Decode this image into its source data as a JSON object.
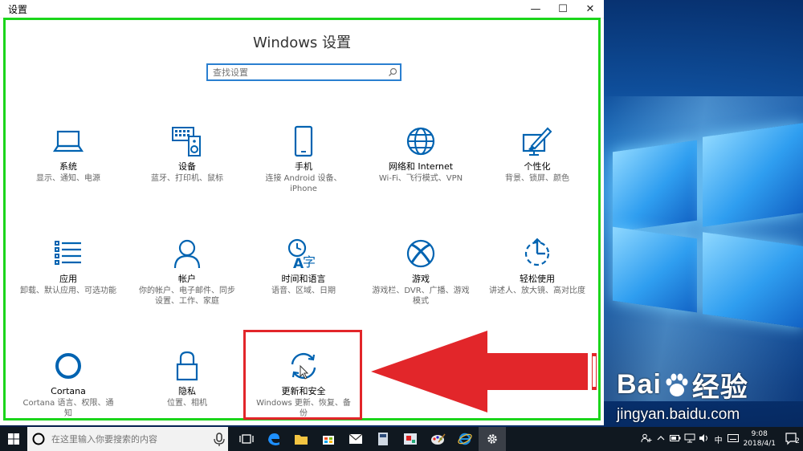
{
  "window": {
    "title": "设置",
    "min_glyph": "—",
    "max_glyph": "☐",
    "close_glyph": "✕"
  },
  "settings": {
    "heading": "Windows 设置",
    "search_placeholder": "查找设置",
    "tiles": [
      {
        "name": "系统",
        "desc": "显示、通知、电源",
        "icon": "laptop-icon"
      },
      {
        "name": "设备",
        "desc": "蓝牙、打印机、鼠标",
        "icon": "keyboard-speaker-icon"
      },
      {
        "name": "手机",
        "desc": "连接 Android 设备、iPhone",
        "icon": "phone-icon"
      },
      {
        "name": "网络和 Internet",
        "desc": "Wi-Fi、飞行模式、VPN",
        "icon": "globe-icon"
      },
      {
        "name": "个性化",
        "desc": "背景、锁屏、颜色",
        "icon": "paint-icon"
      },
      {
        "name": "应用",
        "desc": "卸载、默认应用、可选功能",
        "icon": "app-list-icon"
      },
      {
        "name": "帐户",
        "desc": "你的帐户、电子邮件、同步设置、工作、家庭",
        "icon": "person-icon"
      },
      {
        "name": "时间和语言",
        "desc": "语音、区域、日期",
        "icon": "time-language-icon"
      },
      {
        "name": "游戏",
        "desc": "游戏栏、DVR、广播、游戏模式",
        "icon": "xbox-icon"
      },
      {
        "name": "轻松使用",
        "desc": "讲述人、放大镜、高对比度",
        "icon": "ease-of-access-icon"
      },
      {
        "name": "Cortana",
        "desc": "Cortana 语言、权限、通知",
        "icon": "cortana-icon"
      },
      {
        "name": "隐私",
        "desc": "位置、相机",
        "icon": "lock-icon"
      },
      {
        "name": "更新和安全",
        "desc": "Windows 更新、恢复、备份",
        "icon": "sync-icon"
      }
    ]
  },
  "watermark": {
    "brand_left": "Bai",
    "brand_right": "经验",
    "url": "jingyan.baidu.com"
  },
  "taskbar": {
    "search_placeholder": "在这里输入你要搜索的内容",
    "tray_ime": "中",
    "time": "9:08",
    "date": "2018/4/1",
    "notification_count": "2"
  },
  "colors": {
    "accent": "#0063b1",
    "highlight_border": "#e2262a",
    "content_border": "#1bd51b"
  }
}
